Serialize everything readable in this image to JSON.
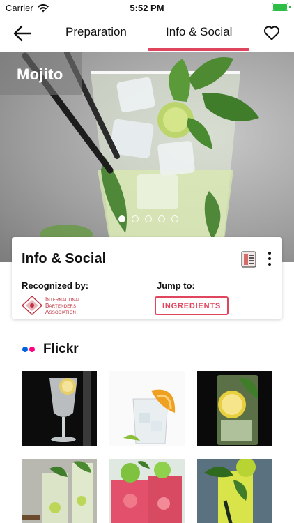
{
  "status": {
    "carrier": "Carrier",
    "time": "5:52 PM"
  },
  "nav": {
    "tabs": [
      {
        "label": "Preparation"
      },
      {
        "label": "Info & Social"
      }
    ],
    "active_tab": 1,
    "accent": "#e0455e"
  },
  "hero": {
    "title": "Mojito",
    "slides": 5,
    "active_slide": 0
  },
  "card": {
    "title": "Info & Social",
    "recognized_label": "Recognized by:",
    "iba_lines": [
      "International",
      "Bartenders",
      "Association"
    ],
    "jump_label": "Jump to:",
    "ingredients_button": "INGREDIENTS"
  },
  "flickr": {
    "title": "Flickr",
    "logo_colors": [
      "#0063dc",
      "#ff0084"
    ],
    "photos": [
      "gin-tonic-glass",
      "iced-cocktail-orange",
      "lemon-mint-highball",
      "mojito-glasses",
      "red-fruit-cocktails",
      "lime-mint-glass"
    ]
  },
  "icons": [
    "back-arrow-icon",
    "heart-icon",
    "wifi-icon",
    "battery-icon",
    "drink-menu-icon",
    "more-vertical-icon",
    "iba-logo-icon"
  ]
}
